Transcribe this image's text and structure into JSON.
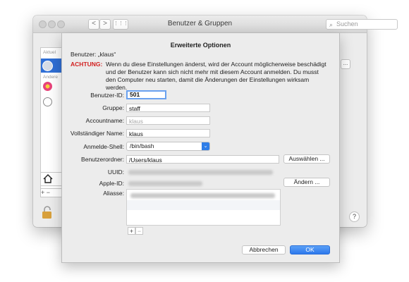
{
  "window": {
    "title": "Benutzer & Gruppen",
    "search_placeholder": "Suchen",
    "back_label": "<",
    "forward_label": ">",
    "grid_label": "⋮⋮⋮",
    "sidebar": {
      "section_current": "Aktuel",
      "section_other": "Andere"
    },
    "plus_minus": "+ −",
    "help_label": "?",
    "options_button": "..."
  },
  "sheet": {
    "title": "Erweiterte Optionen",
    "user_prefix": "Benutzer:",
    "user_name": "„klaus“",
    "warning_label": "ACHTUNG:",
    "warning_text": "Wenn du diese Einstellungen änderst, wird der Account möglicherweise beschädigt und der Benutzer kann sich nicht mehr mit diesem Account anmelden. Du musst den Computer neu starten, damit die Änderungen der Einstellungen wirksam werden.",
    "fields": {
      "user_id_label": "Benutzer-ID:",
      "user_id_value": "501",
      "group_label": "Gruppe:",
      "group_value": "staff",
      "account_label": "Accountname:",
      "account_value": "klaus",
      "fullname_label": "Vollständiger Name:",
      "fullname_value": "klaus",
      "shell_label": "Anmelde-Shell:",
      "shell_value": "/bin/bash",
      "home_label": "Benutzerordner:",
      "home_value": "/Users/klaus",
      "uuid_label": "UUID:",
      "appleid_label": "Apple-ID:",
      "aliases_label": "Aliasse:"
    },
    "buttons": {
      "choose": "Auswählen ...",
      "change": "Ändern ...",
      "add": "+",
      "remove": "−",
      "cancel": "Abbrechen",
      "ok": "OK"
    }
  },
  "colors": {
    "accent": "#2d78ec",
    "warning": "#d21f1f",
    "focus_ring": "#6aa1ef"
  }
}
